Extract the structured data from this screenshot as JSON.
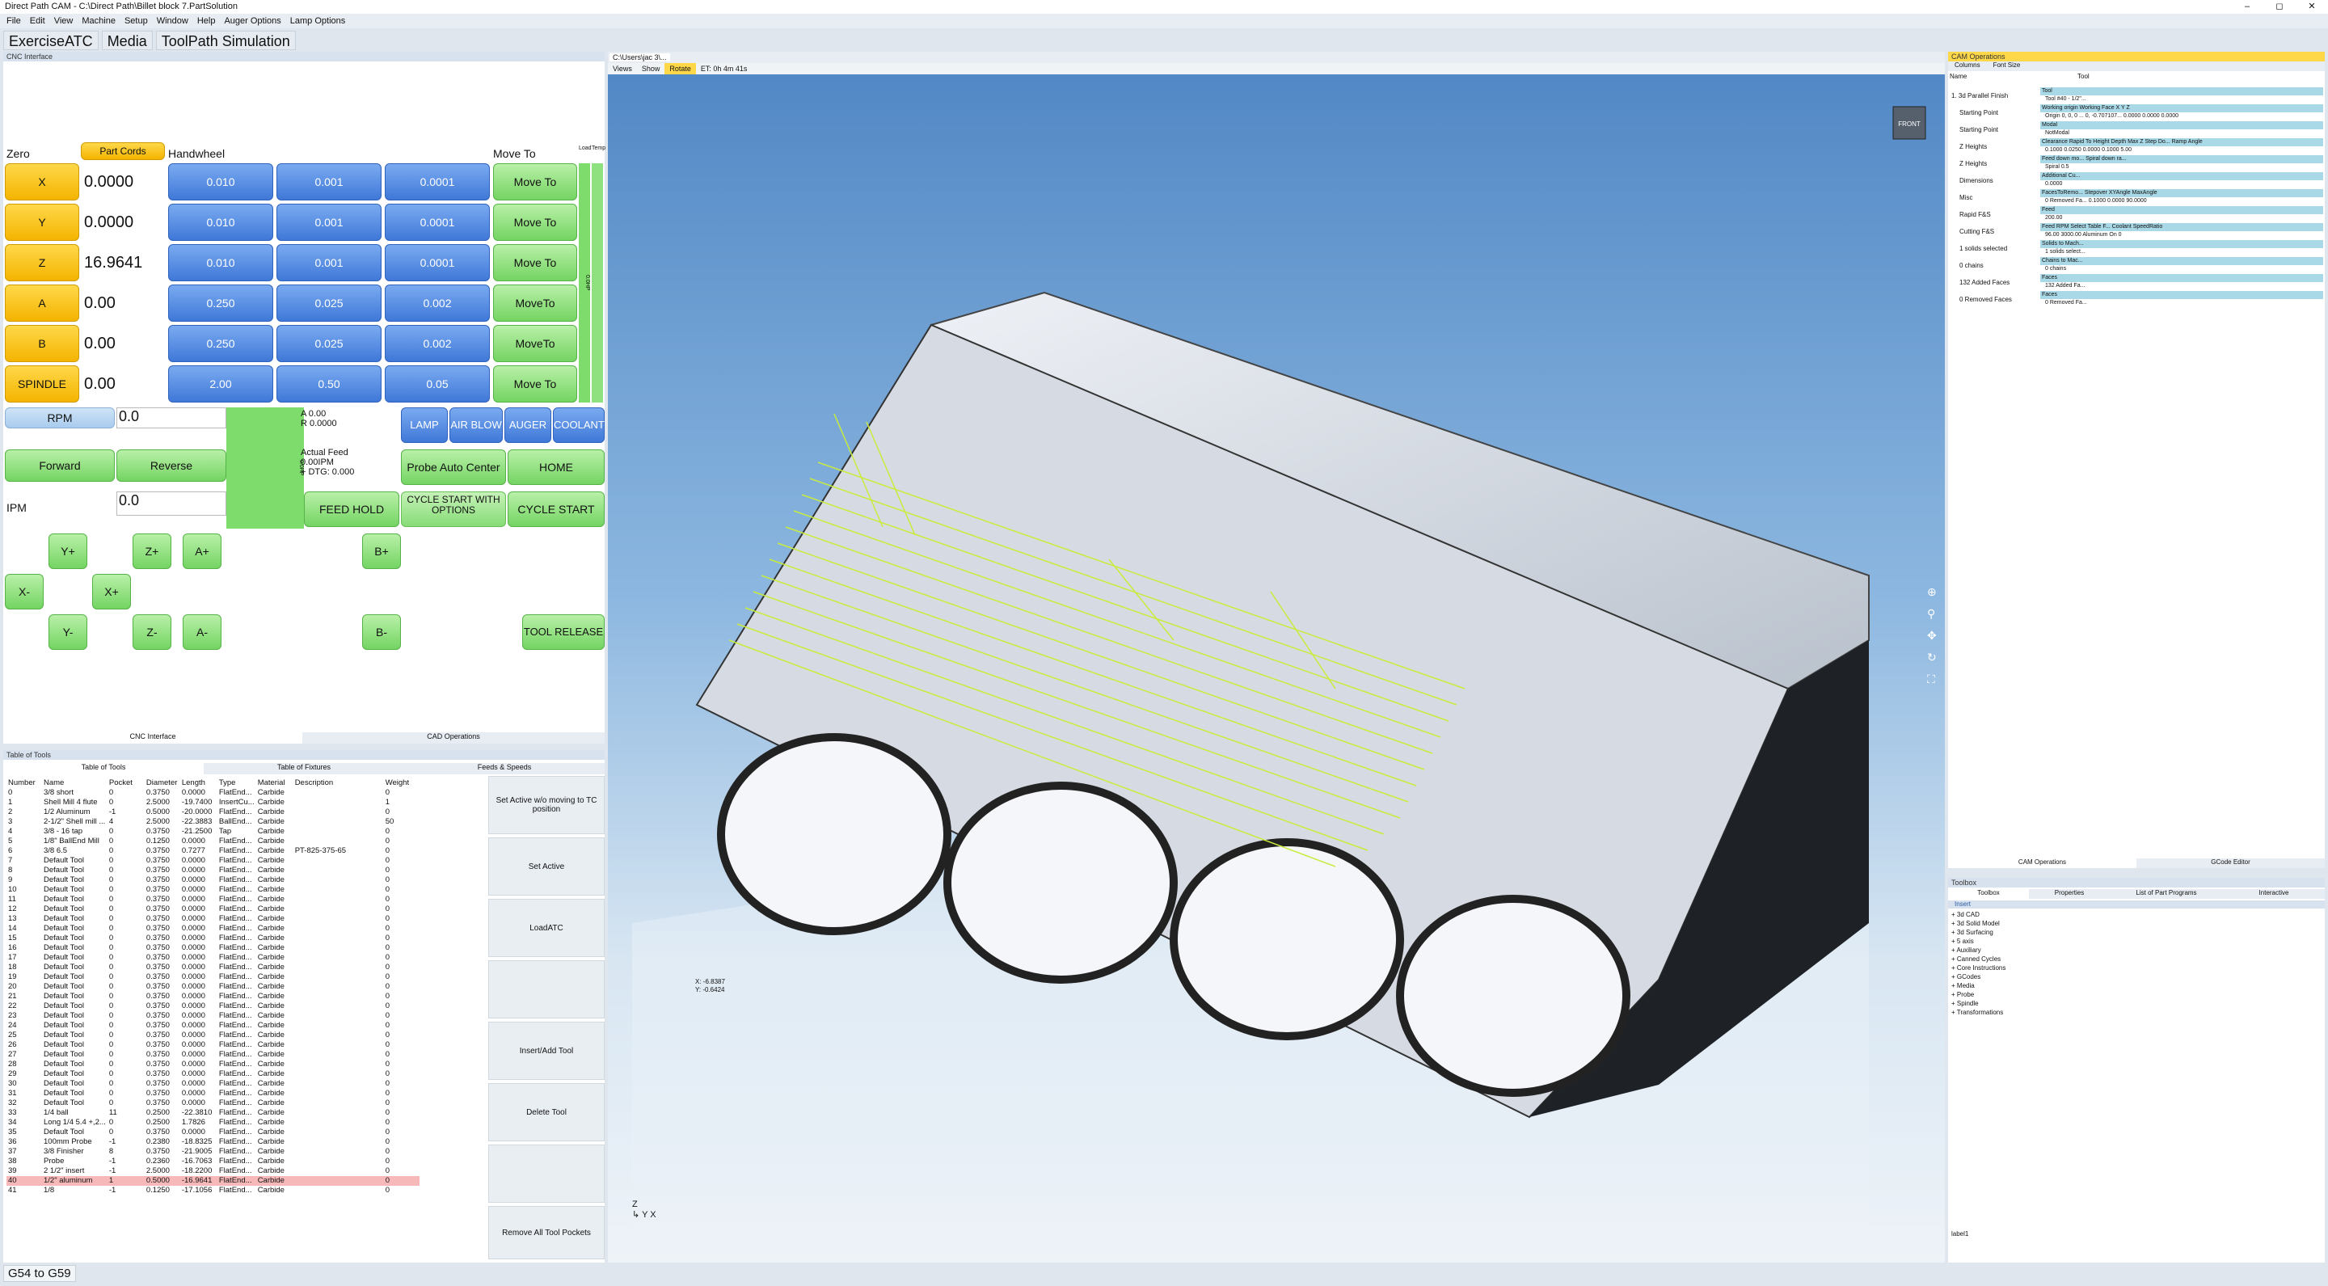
{
  "window": {
    "title": "Direct Path CAM - C:\\Direct Path\\Billet block 7.PartSolution"
  },
  "menu": [
    "File",
    "Edit",
    "View",
    "Machine",
    "Setup",
    "Window",
    "Help",
    "Auger Options",
    "Lamp Options"
  ],
  "tabs": [
    "ExerciseATC",
    "Media",
    "ToolPath Simulation"
  ],
  "cnc": {
    "panel_title": "CNC Interface",
    "zero_label": "Zero",
    "part_cords": "Part Cords",
    "handwheel": "Handwheel",
    "move_to": "Move To",
    "load": "Load",
    "temp": "Temp",
    "axes": [
      {
        "name": "X",
        "value": "0.0000",
        "steps": [
          "0.010",
          "0.001",
          "0.0001"
        ],
        "move": "Move To"
      },
      {
        "name": "Y",
        "value": "0.0000",
        "steps": [
          "0.010",
          "0.001",
          "0.0001"
        ],
        "move": "Move To"
      },
      {
        "name": "Z",
        "value": "16.9641",
        "steps": [
          "0.010",
          "0.001",
          "0.0001"
        ],
        "move": "Move To"
      },
      {
        "name": "A",
        "value": "0.00",
        "steps": [
          "0.250",
          "0.025",
          "0.002"
        ],
        "move": "MoveTo"
      },
      {
        "name": "B",
        "value": "0.00",
        "steps": [
          "0.250",
          "0.025",
          "0.002"
        ],
        "move": "MoveTo"
      },
      {
        "name": "SPINDLE",
        "value": "0.00",
        "steps": [
          "2.00",
          "0.50",
          "0.05"
        ],
        "move": "Move To"
      }
    ],
    "load_text": "0.0HP",
    "rpm_label": "RPM",
    "rpm_value": "0.0",
    "ipm_label": "IPM",
    "ipm_value": "0.0",
    "a_readout": "A 0.00",
    "r_readout": "R 0.0000",
    "actual_feed": "Actual Feed",
    "feed_ipm": "0.00IPM",
    "dtg": "+ DTG: 0.000",
    "lamp": "LAMP",
    "airblow": "AIR BLOW",
    "auger": "AUGER",
    "coolant": "COOLANT",
    "forward": "Forward",
    "reverse": "Reverse",
    "probe": "Probe Auto Center",
    "home": "HOME",
    "feed_hold": "FEED HOLD",
    "cycle_opt": "CYCLE START WITH OPTIONS",
    "cycle_start": "CYCLE START",
    "jog": {
      "yp": "Y+",
      "zp": "Z+",
      "ap": "A+",
      "bp": "B+",
      "xm": "X-",
      "xp": "X+",
      "ym": "Y-",
      "zm": "Z-",
      "am": "A-",
      "bm": "B-"
    },
    "tool_release": "TOOL RELEASE",
    "bottom_tabs": [
      "CNC Interface",
      "CAD Operations"
    ]
  },
  "tools": {
    "panel_title": "Table of Tools",
    "tabs": [
      "Table of Tools",
      "Table of Fixtures",
      "Feeds & Speeds"
    ],
    "headers": [
      "Number",
      "Name",
      "Pocket",
      "Diameter",
      "Length",
      "Type",
      "Material",
      "Description",
      "Weight"
    ],
    "rows": [
      [
        "0",
        "3/8 short",
        "0",
        "0.3750",
        "0.0000",
        "FlatEnd...",
        "Carbide",
        "",
        "0"
      ],
      [
        "1",
        "Shell Mill 4 flute",
        "0",
        "2.5000",
        "-19.7400",
        "InsertCu...",
        "Carbide",
        "",
        "1"
      ],
      [
        "2",
        "1/2 Aluminum",
        "-1",
        "0.5000",
        "-20.0000",
        "FlatEnd...",
        "Carbide",
        "",
        "0"
      ],
      [
        "3",
        "2-1/2\" Shell mill ...",
        "4",
        "2.5000",
        "-22.3883",
        "BallEnd...",
        "Carbide",
        "",
        "50"
      ],
      [
        "4",
        "3/8 - 16 tap",
        "0",
        "0.3750",
        "-21.2500",
        "Tap",
        "Carbide",
        "",
        "0"
      ],
      [
        "5",
        "1/8\" BallEnd Mill",
        "0",
        "0.1250",
        "0.0000",
        "FlatEnd...",
        "Carbide",
        "",
        "0"
      ],
      [
        "6",
        "3/8 6.5",
        "0",
        "0.3750",
        "0.7277",
        "FlatEnd...",
        "Carbide",
        "PT-825-375-65",
        "0"
      ],
      [
        "7",
        "Default Tool",
        "0",
        "0.3750",
        "0.0000",
        "FlatEnd...",
        "Carbide",
        "",
        "0"
      ],
      [
        "8",
        "Default Tool",
        "0",
        "0.3750",
        "0.0000",
        "FlatEnd...",
        "Carbide",
        "",
        "0"
      ],
      [
        "9",
        "Default Tool",
        "0",
        "0.3750",
        "0.0000",
        "FlatEnd...",
        "Carbide",
        "",
        "0"
      ],
      [
        "10",
        "Default Tool",
        "0",
        "0.3750",
        "0.0000",
        "FlatEnd...",
        "Carbide",
        "",
        "0"
      ],
      [
        "11",
        "Default Tool",
        "0",
        "0.3750",
        "0.0000",
        "FlatEnd...",
        "Carbide",
        "",
        "0"
      ],
      [
        "12",
        "Default Tool",
        "0",
        "0.3750",
        "0.0000",
        "FlatEnd...",
        "Carbide",
        "",
        "0"
      ],
      [
        "13",
        "Default Tool",
        "0",
        "0.3750",
        "0.0000",
        "FlatEnd...",
        "Carbide",
        "",
        "0"
      ],
      [
        "14",
        "Default Tool",
        "0",
        "0.3750",
        "0.0000",
        "FlatEnd...",
        "Carbide",
        "",
        "0"
      ],
      [
        "15",
        "Default Tool",
        "0",
        "0.3750",
        "0.0000",
        "FlatEnd...",
        "Carbide",
        "",
        "0"
      ],
      [
        "16",
        "Default Tool",
        "0",
        "0.3750",
        "0.0000",
        "FlatEnd...",
        "Carbide",
        "",
        "0"
      ],
      [
        "17",
        "Default Tool",
        "0",
        "0.3750",
        "0.0000",
        "FlatEnd...",
        "Carbide",
        "",
        "0"
      ],
      [
        "18",
        "Default Tool",
        "0",
        "0.3750",
        "0.0000",
        "FlatEnd...",
        "Carbide",
        "",
        "0"
      ],
      [
        "19",
        "Default Tool",
        "0",
        "0.3750",
        "0.0000",
        "FlatEnd...",
        "Carbide",
        "",
        "0"
      ],
      [
        "20",
        "Default Tool",
        "0",
        "0.3750",
        "0.0000",
        "FlatEnd...",
        "Carbide",
        "",
        "0"
      ],
      [
        "21",
        "Default Tool",
        "0",
        "0.3750",
        "0.0000",
        "FlatEnd...",
        "Carbide",
        "",
        "0"
      ],
      [
        "22",
        "Default Tool",
        "0",
        "0.3750",
        "0.0000",
        "FlatEnd...",
        "Carbide",
        "",
        "0"
      ],
      [
        "23",
        "Default Tool",
        "0",
        "0.3750",
        "0.0000",
        "FlatEnd...",
        "Carbide",
        "",
        "0"
      ],
      [
        "24",
        "Default Tool",
        "0",
        "0.3750",
        "0.0000",
        "FlatEnd...",
        "Carbide",
        "",
        "0"
      ],
      [
        "25",
        "Default Tool",
        "0",
        "0.3750",
        "0.0000",
        "FlatEnd...",
        "Carbide",
        "",
        "0"
      ],
      [
        "26",
        "Default Tool",
        "0",
        "0.3750",
        "0.0000",
        "FlatEnd...",
        "Carbide",
        "",
        "0"
      ],
      [
        "27",
        "Default Tool",
        "0",
        "0.3750",
        "0.0000",
        "FlatEnd...",
        "Carbide",
        "",
        "0"
      ],
      [
        "28",
        "Default Tool",
        "0",
        "0.3750",
        "0.0000",
        "FlatEnd...",
        "Carbide",
        "",
        "0"
      ],
      [
        "29",
        "Default Tool",
        "0",
        "0.3750",
        "0.0000",
        "FlatEnd...",
        "Carbide",
        "",
        "0"
      ],
      [
        "30",
        "Default Tool",
        "0",
        "0.3750",
        "0.0000",
        "FlatEnd...",
        "Carbide",
        "",
        "0"
      ],
      [
        "31",
        "Default Tool",
        "0",
        "0.3750",
        "0.0000",
        "FlatEnd...",
        "Carbide",
        "",
        "0"
      ],
      [
        "32",
        "Default Tool",
        "0",
        "0.3750",
        "0.0000",
        "FlatEnd...",
        "Carbide",
        "",
        "0"
      ],
      [
        "33",
        "1/4 ball",
        "11",
        "0.2500",
        "-22.3810",
        "FlatEnd...",
        "Carbide",
        "",
        "0"
      ],
      [
        "34",
        "Long 1/4 5.4 +,2...",
        "0",
        "0.2500",
        "1.7826",
        "FlatEnd...",
        "Carbide",
        "",
        "0"
      ],
      [
        "35",
        "Default Tool",
        "0",
        "0.3750",
        "0.0000",
        "FlatEnd...",
        "Carbide",
        "",
        "0"
      ],
      [
        "36",
        "100mm Probe",
        "-1",
        "0.2380",
        "-18.8325",
        "FlatEnd...",
        "Carbide",
        "",
        "0"
      ],
      [
        "37",
        "3/8 Finisher",
        "8",
        "0.3750",
        "-21.9005",
        "FlatEnd...",
        "Carbide",
        "",
        "0"
      ],
      [
        "38",
        "Probe",
        "-1",
        "0.2360",
        "-16.7063",
        "FlatEnd...",
        "Carbide",
        "",
        "0"
      ],
      [
        "39",
        "2 1/2\" insert",
        "-1",
        "2.5000",
        "-18.2200",
        "FlatEnd...",
        "Carbide",
        "",
        "0"
      ],
      [
        "40",
        "1/2\" aluminum",
        "1",
        "0.5000",
        "-16.9641",
        "FlatEnd...",
        "Carbide",
        "",
        "0"
      ],
      [
        "41",
        "1/8",
        "-1",
        "0.1250",
        "-17.1056",
        "FlatEnd...",
        "Carbide",
        "",
        "0"
      ]
    ],
    "actions": [
      "Set Active w/o moving to TC position",
      "Set Active",
      "LoadATC",
      "",
      "Insert/Add Tool",
      "Delete Tool",
      "",
      "Remove All Tool Pockets"
    ]
  },
  "viewport": {
    "doc_tab": "C:\\Users\\jac 3\\...",
    "tb_views": "Views",
    "tb_show": "Show",
    "tb_rotate": "Rotate",
    "tb_et": "ET: 0h 4m 41s",
    "cube": "FRONT",
    "coord_x": "X: -6.8387",
    "coord_y": "Y: -0.6424"
  },
  "camops": {
    "panel_title": "CAM Operations",
    "columns": "Columns",
    "font_size": "Font Size",
    "h_name": "Name",
    "h_tool": "Tool",
    "tree": [
      "1. 3d Parallel Finish",
      "Starting Point",
      "Starting Point",
      "Z Heights",
      "Z Heights",
      "Dimensions",
      "Misc",
      "Rapid F&S",
      "Cutting F&S",
      "1 solids selected",
      "0 chains",
      "132 Added Faces",
      "0 Removed Faces"
    ],
    "details": [
      {
        "h": "Tool",
        "v": "Tool #40 - 1/2\"..."
      },
      {
        "h": "Working origin   Working Face   X   Y   Z",
        "v": "Origin 0, 0, 0 ...   0, -0.707107...   0.0000   0.0000   0.0000"
      },
      {
        "h": "Modal",
        "v": "NotModal"
      },
      {
        "h": "Clearance   Rapid To Height   Depth   Max Z Step Do...   Ramp Angle",
        "v": "0.1000   0.0250   0.0000   0.1000   5.00"
      },
      {
        "h": "Feed down mo...   Spiral down ra...",
        "v": "Spiral   0.5"
      },
      {
        "h": "Additional Cu...",
        "v": "0.0000"
      },
      {
        "h": "FacesToRemo...   Stepover   XYAngle   MaxAngle",
        "v": "0 Removed Fa...   0.1000   0.0000   90.0000"
      },
      {
        "h": "Feed",
        "v": "200.00"
      },
      {
        "h": "Feed   RPM   Select Table F...   Coolant   SpeedRatio",
        "v": "96.00   3000.00   Aluminum   On   0"
      },
      {
        "h": "Solids to Mach...",
        "v": "1 solids select..."
      },
      {
        "h": "Chains to Mac...",
        "v": "0 chains"
      },
      {
        "h": "Faces",
        "v": "132 Added Fa..."
      },
      {
        "h": "Faces",
        "v": "0 Removed Fa..."
      }
    ],
    "bottom_tabs": [
      "CAM Operations",
      "GCode Editor"
    ]
  },
  "toolbox": {
    "panel_title": "Toolbox",
    "tabs": [
      "Toolbox",
      "Properties",
      "List of Part Programs",
      "Interactive"
    ],
    "section": "Insert",
    "items": [
      "3d CAD",
      "3d Solid Model",
      "3d Surfacing",
      "5 axis",
      "Auxiliary",
      "Canned Cycles",
      "Core Instructions",
      "GCodes",
      "Media",
      "Probe",
      "Spindle",
      "Transformations"
    ],
    "footer": "label1"
  },
  "status": {
    "button": "G54 to G59"
  },
  "colors": {
    "yellow": "#f4b400",
    "blue": "#3f78d8",
    "green": "#74d462",
    "selected_row": "#f6b8b8",
    "viewport_top": "#4f86c4",
    "toolpath": "#c8ec3c"
  }
}
